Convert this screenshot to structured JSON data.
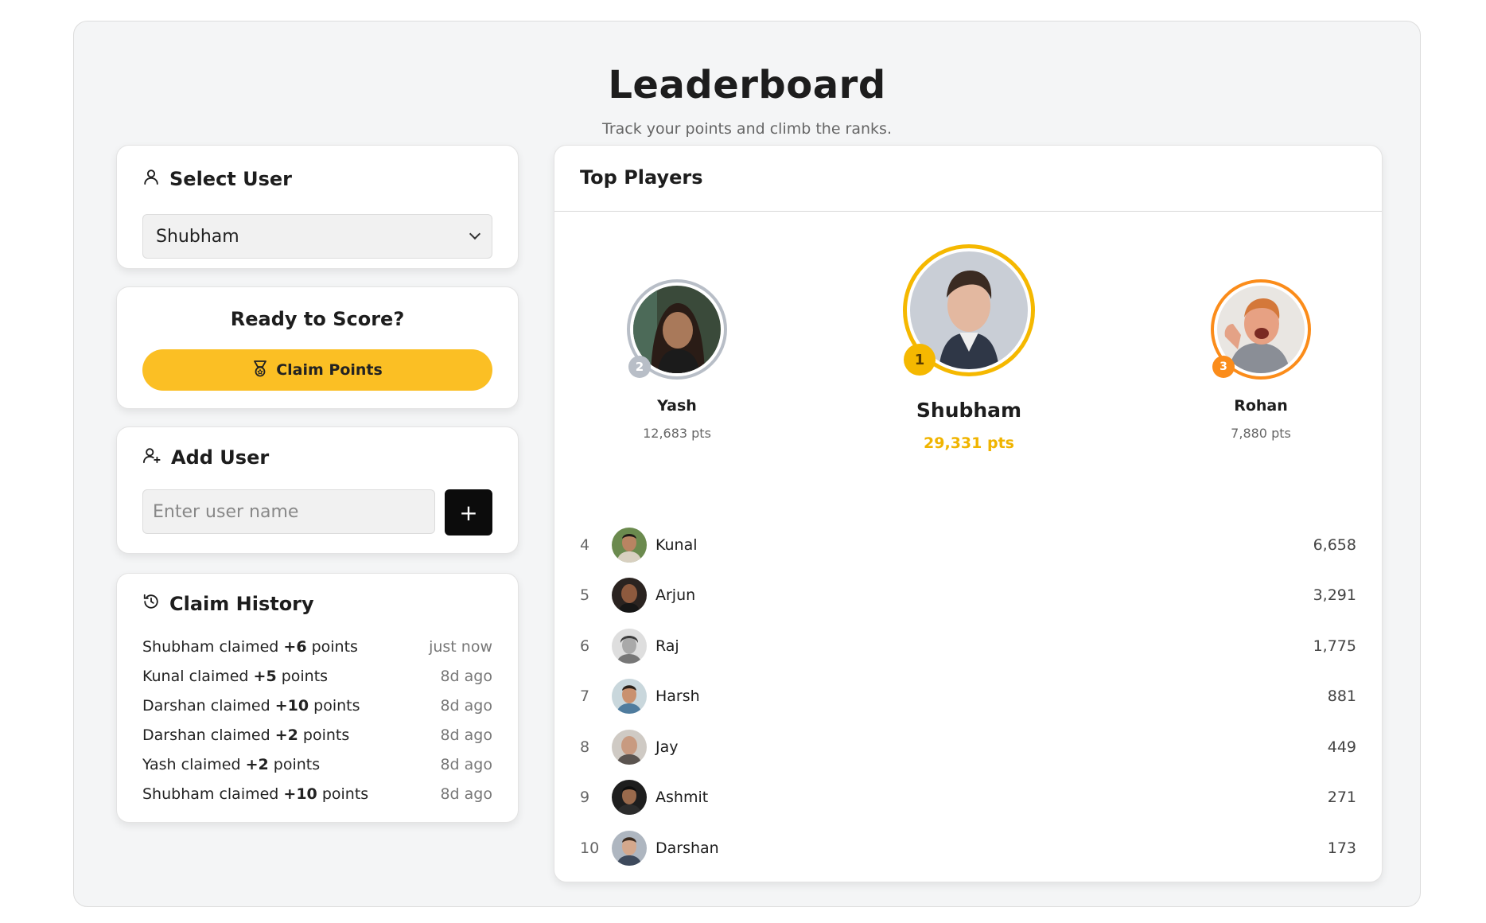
{
  "header": {
    "title": "Leaderboard",
    "subtitle": "Track your points and climb the ranks."
  },
  "select_user": {
    "title": "Select User",
    "selected": "Shubham"
  },
  "claim": {
    "title": "Ready to Score?",
    "button_label": "Claim Points"
  },
  "add_user": {
    "title": "Add User",
    "placeholder": "Enter user name",
    "button_label": "+"
  },
  "history": {
    "title": "Claim History",
    "items": [
      {
        "name": "Shubham",
        "verb": "claimed",
        "points": "+6",
        "unit": "points",
        "time": "just now"
      },
      {
        "name": "Kunal",
        "verb": "claimed",
        "points": "+5",
        "unit": "points",
        "time": "8d ago"
      },
      {
        "name": "Darshan",
        "verb": "claimed",
        "points": "+10",
        "unit": "points",
        "time": "8d ago"
      },
      {
        "name": "Darshan",
        "verb": "claimed",
        "points": "+2",
        "unit": "points",
        "time": "8d ago"
      },
      {
        "name": "Yash",
        "verb": "claimed",
        "points": "+2",
        "unit": "points",
        "time": "8d ago"
      },
      {
        "name": "Shubham",
        "verb": "claimed",
        "points": "+10",
        "unit": "points",
        "time": "8d ago"
      }
    ]
  },
  "top_players": {
    "title": "Top Players",
    "podium": {
      "first": {
        "rank": "1",
        "name": "Shubham",
        "points": "29,331 pts"
      },
      "second": {
        "rank": "2",
        "name": "Yash",
        "points": "12,683 pts"
      },
      "third": {
        "rank": "3",
        "name": "Rohan",
        "points": "7,880 pts"
      }
    },
    "rows": [
      {
        "rank": "4",
        "name": "Kunal",
        "score": "6,658"
      },
      {
        "rank": "5",
        "name": "Arjun",
        "score": "3,291"
      },
      {
        "rank": "6",
        "name": "Raj",
        "score": "1,775"
      },
      {
        "rank": "7",
        "name": "Harsh",
        "score": "881"
      },
      {
        "rank": "8",
        "name": "Jay",
        "score": "449"
      },
      {
        "rank": "9",
        "name": "Ashmit",
        "score": "271"
      },
      {
        "rank": "10",
        "name": "Darshan",
        "score": "173"
      }
    ]
  },
  "colors": {
    "accent": "#fbbf24",
    "gold": "#f5b800",
    "silver": "#b8bec7",
    "bronze": "#fb8c1a",
    "dark_button": "#0c0c0c"
  }
}
